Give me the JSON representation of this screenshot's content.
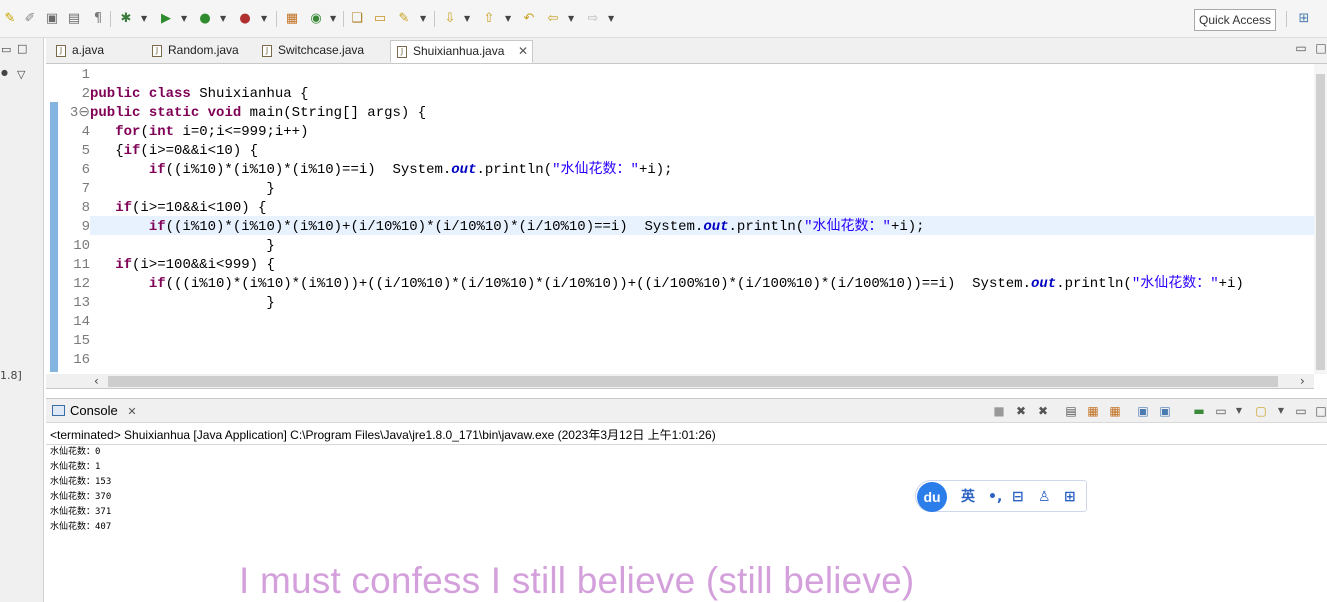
{
  "toolbar": {
    "quick_access": "Quick Access",
    "icons": [
      "edit-icon",
      "pencil-icon",
      "save-icon",
      "print-icon",
      "paragraph-icon",
      "debug-icon",
      "run-icon",
      "coverage-icon",
      "external-tools-icon",
      "new-package-icon",
      "new-class-icon",
      "open-type-icon",
      "open-task-icon",
      "search-icon",
      "next-annotation-icon",
      "previous-annotation-icon",
      "last-edit-icon",
      "back-icon",
      "forward-icon",
      "perspective-icon"
    ]
  },
  "left_strip": {
    "version_hint": "1.8]"
  },
  "editor": {
    "tabs": [
      {
        "label": "a.java",
        "active": false
      },
      {
        "label": "Random.java",
        "active": false
      },
      {
        "label": "Switchcase.java",
        "active": false
      },
      {
        "label": "Shuixianhua.java",
        "active": true
      }
    ],
    "line_numbers": [
      "1",
      "2",
      "3⊖",
      "4",
      "5",
      "6",
      "7",
      "8",
      "9",
      "10",
      "11",
      "12",
      "13",
      "14",
      "15",
      "16"
    ],
    "lines": [
      "",
      "public class Shuixianhua {",
      "public static void main(String[] args) {",
      "   for(int i=0;i<=999;i++)",
      "   {if(i>=0&&i<10) {",
      "       if((i%10)*(i%10)*(i%10)==i)  System.out.println(\"水仙花数：\"+i);",
      "                     }",
      "   if(i>=10&&i<100) {",
      "       if((i%10)*(i%10)*(i%10)+(i/10%10)*(i/10%10)*(i/10%10)==i)  System.out.println(\"水仙花数：\"+i);",
      "                     }",
      "   if(i>=100&&i<999) {",
      "       if(((i%10)*(i%10)*(i%10))+((i/10%10)*(i/10%10)*(i/10%10))+((i/100%10)*(i/100%10)*(i/100%10))==i)  System.out.println(\"水仙花数：\"+i)",
      "                     }",
      "",
      "",
      ""
    ]
  },
  "console": {
    "tab_label": "Console",
    "status": "<terminated> Shuixianhua [Java Application] C:\\Program Files\\Java\\jre1.8.0_171\\bin\\javaw.exe (2023年3月12日 上午1:01:26)",
    "output": [
      "水仙花数：0",
      "水仙花数：1",
      "水仙花数：153",
      "水仙花数：370",
      "水仙花数：371",
      "水仙花数：407"
    ]
  },
  "ime": {
    "logo": "du",
    "mode": "英",
    "punct": "•,",
    "items": [
      "toolbox-icon",
      "user-icon",
      "grid-icon"
    ]
  },
  "subtitle": "I must confess I still believe (still believe)"
}
